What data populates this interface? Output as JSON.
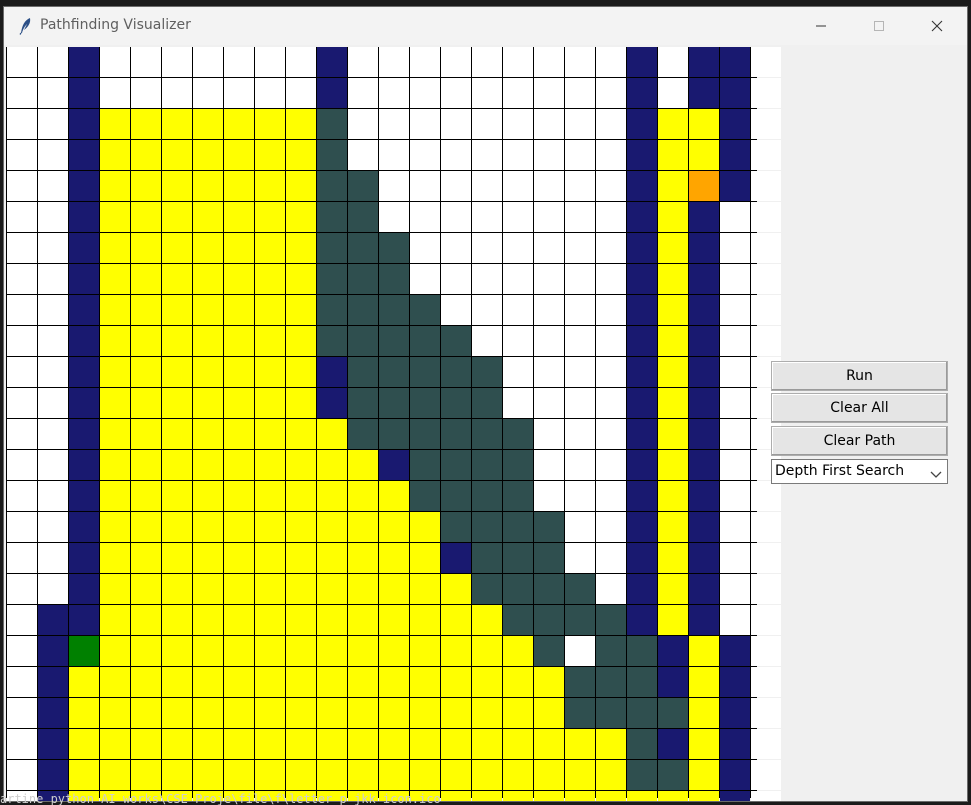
{
  "window": {
    "title": "Pathfinding Visualizer"
  },
  "controls": {
    "run_label": "Run",
    "clear_all_label": "Clear All",
    "clear_path_label": "Clear Path",
    "algorithm_selected": "Depth First Search"
  },
  "legend_colors": {
    "empty": "#ffffff",
    "barrier": "#191970",
    "visited": "#ffff00",
    "frontier": "#2f4f4f",
    "start": "#008000",
    "end": "#ffa500",
    "grid_line": "#000000"
  },
  "grid": {
    "rows": 25,
    "cols": 25,
    "cells": [
      "..B.......B.........B.BB.",
      "..B.......B.........B.BB.",
      "..BYYYYYYYF.........BYYB.",
      "..BYYYYYYYF.........BYYB.",
      "..BYYYYYYYFF........BYEB.",
      "..BYYYYYYYFF........BYB..",
      "..BYYYYYYYFFF.......BYB..",
      "..BYYYYYYYFFF.......BYB..",
      "..BYYYYYYYFFFF......BYB..",
      "..BYYYYYYYFFFFF.....BYB..",
      "..BYYYYYYYBFFFFF....BYB..",
      "..BYYYYYYYBFFFFF....BYB..",
      "..BYYYYYYYYFFFFFF...BYB..",
      "..BYYYYYYYYYBFFFF...BYB..",
      "..BYYYYYYYYYYFFFF...BYB..",
      "..BYYYYYYYYYYYFFFF..BYB..",
      "..BYYYYYYYYYYYBFFF..BYB..",
      "..BYYYYYYYYYYYYFFFF.BYB..",
      ".BBYYYYYYYYYYYYYFFFFBYB..",
      ".BSYYYYYYYYYYYYYYF.FFBYB..",
      ".BYYYYYYYYYYYYYYYYFFFBYB..",
      ".BYYYYYYYYYYYYYYYYFFFFYB..",
      ".BYYYYYYYYYYYYYYYYYYFBYB..",
      ".BYYYYYYYYYYYYYYYYYYFFYB..",
      ".BYYYYYYYYYYYYYYYYYYYYYB.."
    ]
  },
  "terminal": {
    "text": "artine python AI works\\CSE Proje\\file\\f\\letter p jkk icon.ico"
  }
}
